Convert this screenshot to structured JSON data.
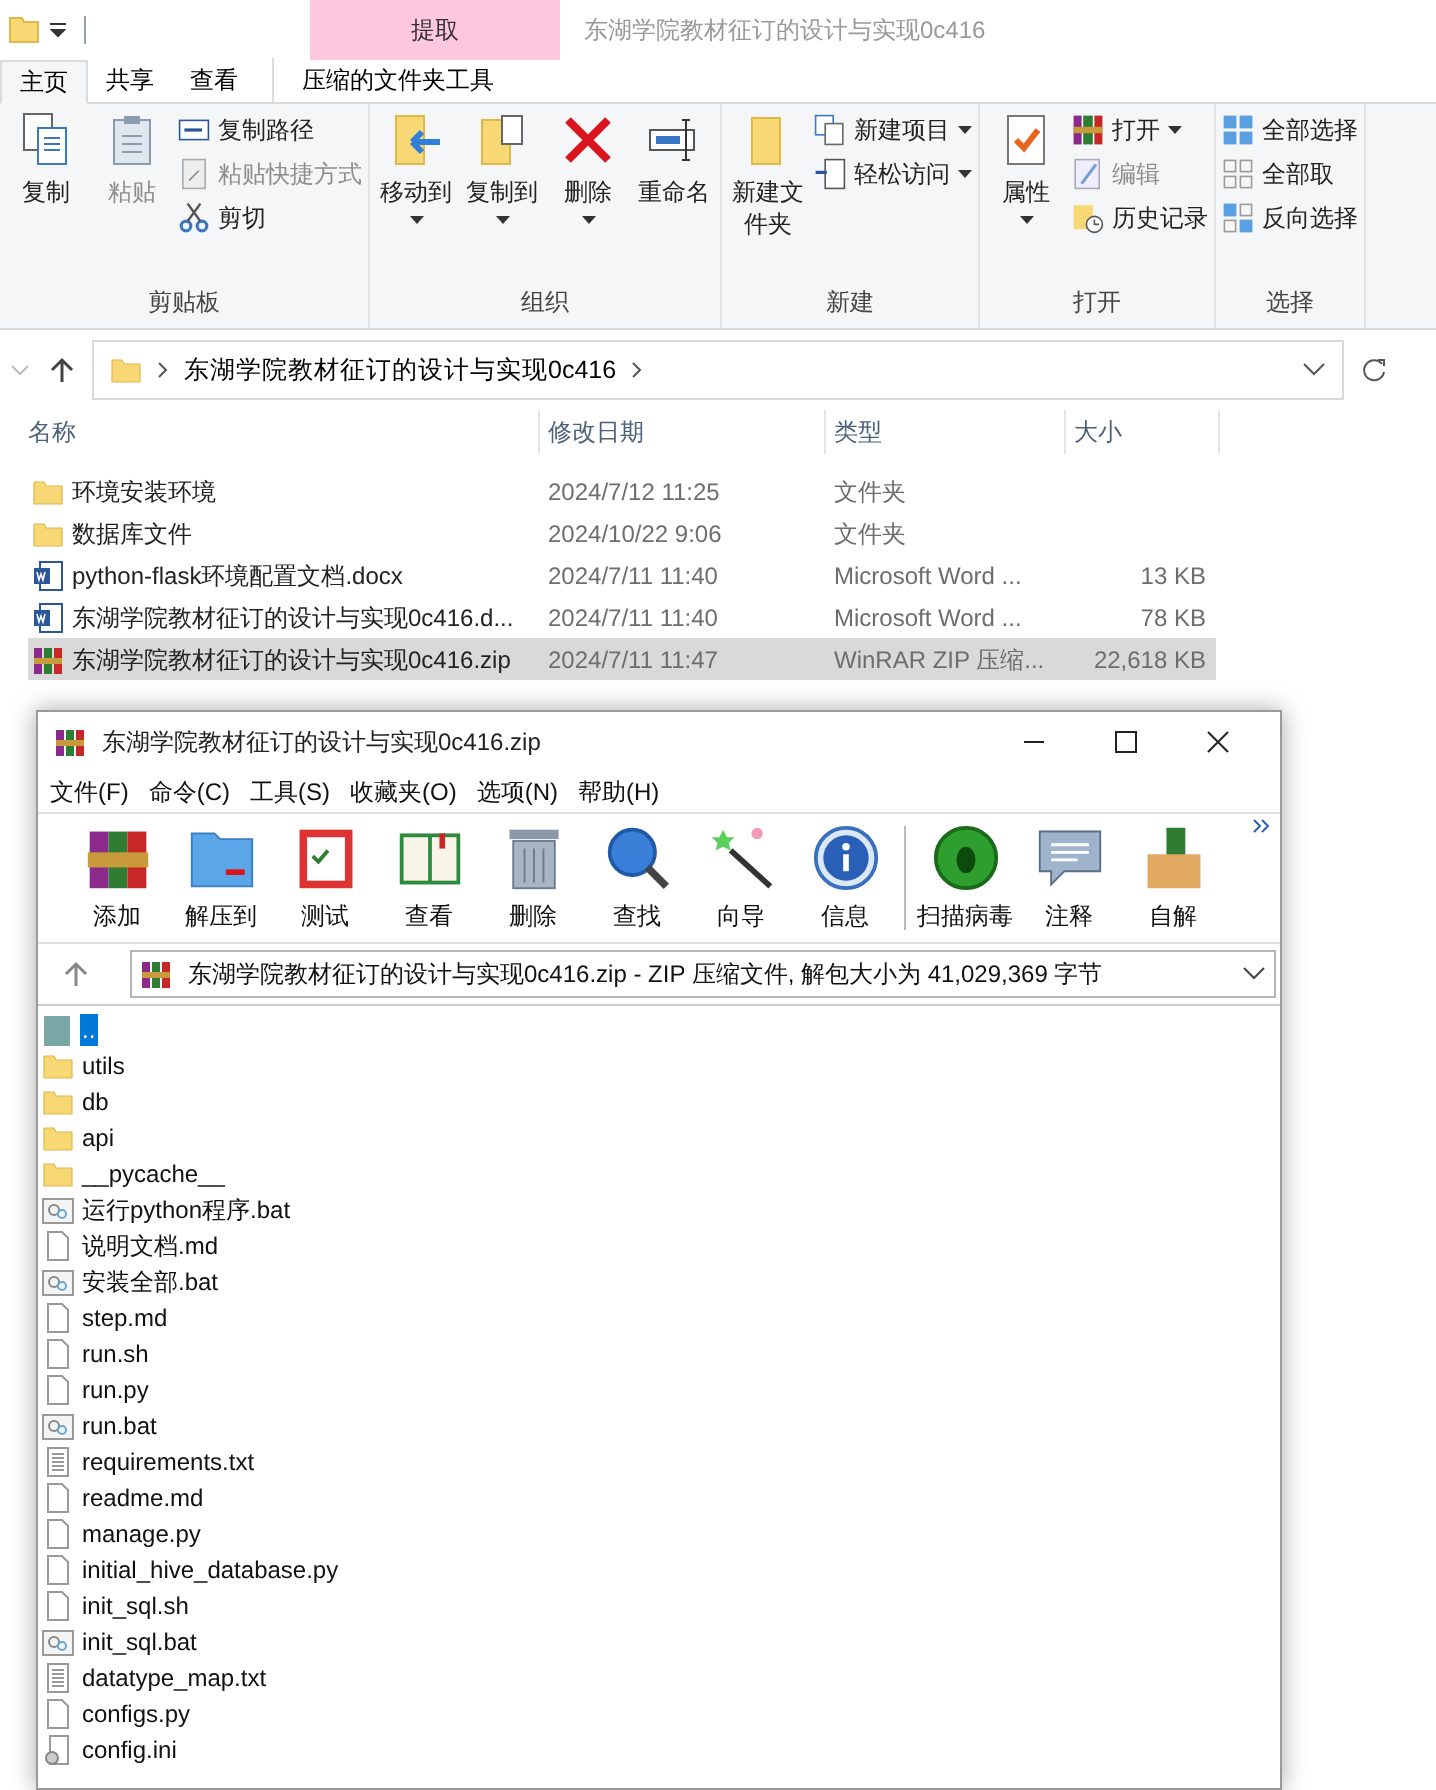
{
  "explorer": {
    "title": "东湖学院教材征订的设计与实现0c416",
    "context_header": "提取",
    "tabs": [
      {
        "label": "主页",
        "selected": true
      },
      {
        "label": "共享",
        "selected": false
      },
      {
        "label": "查看",
        "selected": false
      },
      {
        "label": "压缩的文件夹工具",
        "selected": false,
        "kind": "context"
      }
    ],
    "ribbon_groups": [
      {
        "label": "剪贴板",
        "large": [
          {
            "label": "复制",
            "kind": "copy",
            "disabled": false,
            "dropdown": false
          },
          {
            "label": "粘贴",
            "kind": "paste",
            "disabled": true,
            "dropdown": false
          }
        ],
        "small": [
          {
            "label": "复制路径",
            "kind": "copy-path",
            "disabled": false,
            "dropdown": false
          },
          {
            "label": "粘贴快捷方式",
            "kind": "paste-shortcut",
            "disabled": true,
            "dropdown": false
          },
          {
            "label": "剪切",
            "kind": "cut",
            "disabled": false,
            "dropdown": false
          }
        ]
      },
      {
        "label": "组织",
        "large": [
          {
            "label": "移动到",
            "kind": "move",
            "disabled": false,
            "dropdown": true
          },
          {
            "label": "复制到",
            "kind": "copy-to",
            "disabled": false,
            "dropdown": true
          },
          {
            "label": "删除",
            "kind": "delete",
            "disabled": false,
            "dropdown": true
          },
          {
            "label": "重命名",
            "kind": "rename",
            "disabled": false,
            "dropdown": false
          }
        ]
      },
      {
        "label": "新建",
        "large": [
          {
            "label": "新建文件夹",
            "kind": "new-folder",
            "disabled": false,
            "dropdown": false
          }
        ],
        "small": [
          {
            "label": "新建项目",
            "kind": "new-item",
            "disabled": false,
            "dropdown": true
          },
          {
            "label": "轻松访问",
            "kind": "easy-access",
            "disabled": false,
            "dropdown": true
          }
        ]
      },
      {
        "label": "打开",
        "large": [
          {
            "label": "属性",
            "kind": "properties",
            "disabled": false,
            "dropdown": true
          }
        ],
        "small": [
          {
            "label": "打开",
            "kind": "open",
            "disabled": false,
            "dropdown": true
          },
          {
            "label": "编辑",
            "kind": "edit",
            "disabled": true,
            "dropdown": false
          },
          {
            "label": "历史记录",
            "kind": "history",
            "disabled": false,
            "dropdown": false
          }
        ]
      },
      {
        "label": "选择",
        "small": [
          {
            "label": "全部选择",
            "kind": "select-all",
            "disabled": false,
            "dropdown": false
          },
          {
            "label": "全部取",
            "kind": "select-none",
            "disabled": false,
            "dropdown": false
          },
          {
            "label": "反向选择",
            "kind": "invert",
            "disabled": false,
            "dropdown": false
          }
        ]
      }
    ],
    "address": "东湖学院教材征订的设计与实现0c416",
    "columns": [
      "名称",
      "修改日期",
      "类型",
      "大小"
    ],
    "files": [
      {
        "name": "环境安装环境",
        "date": "2024/7/12 11:25",
        "type": "文件夹",
        "kind": "folder",
        "selected": false
      },
      {
        "name": "数据库文件",
        "date": "2024/10/22 9:06",
        "type": "文件夹",
        "kind": "folder",
        "selected": false
      },
      {
        "name": "python-flask环境配置文档.docx",
        "date": "2024/7/11 11:40",
        "type": "Microsoft Word ...",
        "size": "13 KB",
        "kind": "word",
        "selected": false
      },
      {
        "name": "东湖学院教材征订的设计与实现0c416.d...",
        "date": "2024/7/11 11:40",
        "type": "Microsoft Word ...",
        "size": "78 KB",
        "kind": "word",
        "selected": false
      },
      {
        "name": "东湖学院教材征订的设计与实现0c416.zip",
        "date": "2024/7/11 11:47",
        "type": "WinRAR ZIP 压缩...",
        "size": "22,618 KB",
        "kind": "rar",
        "selected": true
      }
    ]
  },
  "winrar": {
    "title": "东湖学院教材征订的设计与实现0c416.zip",
    "menu": [
      "文件(F)",
      "命令(C)",
      "工具(S)",
      "收藏夹(O)",
      "选项(N)",
      "帮助(H)"
    ],
    "toolbar": [
      {
        "label": "添加",
        "kind": "add"
      },
      {
        "label": "解压到",
        "kind": "extract"
      },
      {
        "label": "测试",
        "kind": "test"
      },
      {
        "label": "查看",
        "kind": "view"
      },
      {
        "label": "删除",
        "kind": "delete"
      },
      {
        "label": "查找",
        "kind": "find"
      },
      {
        "label": "向导",
        "kind": "wizard"
      },
      {
        "label": "信息",
        "kind": "info"
      },
      {
        "label": "扫描病毒",
        "kind": "virus"
      },
      {
        "label": "注释",
        "kind": "comment"
      },
      {
        "label": "自解",
        "kind": "sfx"
      }
    ],
    "address": "东湖学院教材征订的设计与实现0c416.zip - ZIP 压缩文件, 解包大小为 41,029,369 字节",
    "files": [
      {
        "name": "..",
        "kind": "up",
        "selected": true
      },
      {
        "name": "utils",
        "kind": "folder",
        "selected": false
      },
      {
        "name": "db",
        "kind": "folder",
        "selected": false
      },
      {
        "name": "api",
        "kind": "folder",
        "selected": false
      },
      {
        "name": "__pycache__",
        "kind": "folder",
        "selected": false
      },
      {
        "name": "运行python程序.bat",
        "kind": "bat",
        "selected": false
      },
      {
        "name": "说明文档.md",
        "kind": "file",
        "selected": false
      },
      {
        "name": "安装全部.bat",
        "kind": "bat",
        "selected": false
      },
      {
        "name": "step.md",
        "kind": "file",
        "selected": false
      },
      {
        "name": "run.sh",
        "kind": "file",
        "selected": false
      },
      {
        "name": "run.py",
        "kind": "file",
        "selected": false
      },
      {
        "name": "run.bat",
        "kind": "bat",
        "selected": false
      },
      {
        "name": "requirements.txt",
        "kind": "txt",
        "selected": false
      },
      {
        "name": "readme.md",
        "kind": "file",
        "selected": false
      },
      {
        "name": "manage.py",
        "kind": "file",
        "selected": false
      },
      {
        "name": "initial_hive_database.py",
        "kind": "file",
        "selected": false
      },
      {
        "name": "init_sql.sh",
        "kind": "file",
        "selected": false
      },
      {
        "name": "init_sql.bat",
        "kind": "bat",
        "selected": false
      },
      {
        "name": "datatype_map.txt",
        "kind": "txt",
        "selected": false
      },
      {
        "name": "configs.py",
        "kind": "file",
        "selected": false
      },
      {
        "name": "config.ini",
        "kind": "ini",
        "selected": false
      }
    ]
  }
}
